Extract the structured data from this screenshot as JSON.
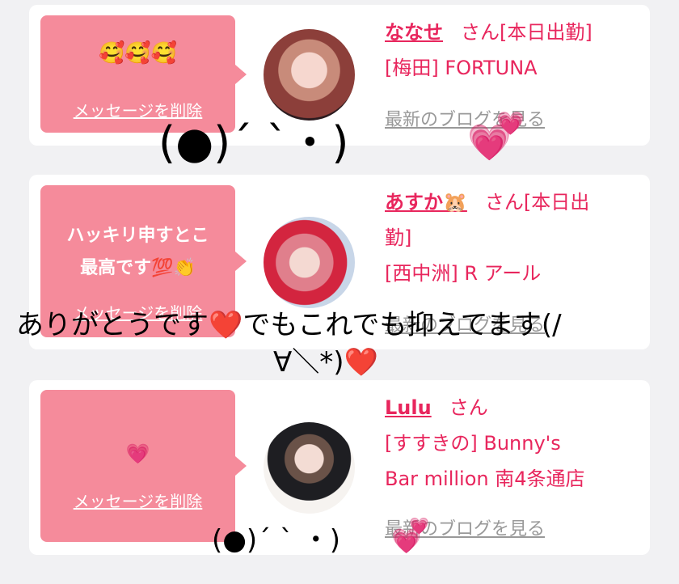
{
  "cards": [
    {
      "message": "🥰🥰🥰",
      "delete_label": "メッセージを削除",
      "name": "ななせ",
      "suffix": "さん[本日出勤]",
      "shop": "[梅田] FORTUNA",
      "blog_label": "最新のブログを見る"
    },
    {
      "message_line1": "ハッキリ申すとこ",
      "message_line2": "最高です💯👏",
      "delete_label": "メッセージを削除",
      "name": "あすか🐹",
      "suffix": "さん[本日出",
      "suffix_line2": "勤]",
      "shop": "[西中洲] R アール",
      "blog_label": "最新のブログを見る"
    },
    {
      "message": "💗",
      "delete_label": "メッセージを削除",
      "name": "Lulu",
      "suffix": "さん",
      "shop_line1": "[すすきの] Bunny's",
      "shop_line2": "Bar million 南4条通店",
      "blog_label": "最新のブログを見る"
    }
  ],
  "overlays": {
    "kaomoji_top": "(●)´ `・)",
    "thanks_line1": "ありがとうです❤️でもこれでも抑えてます(/",
    "thanks_line2": "∀＼*)❤️",
    "kaomoji_bottom": "(●)´ ` ・)"
  },
  "colors": {
    "accent": "#e8265d",
    "bubble": "#f58b9b",
    "card": "#ffffff",
    "background": "#f1f1f3"
  }
}
